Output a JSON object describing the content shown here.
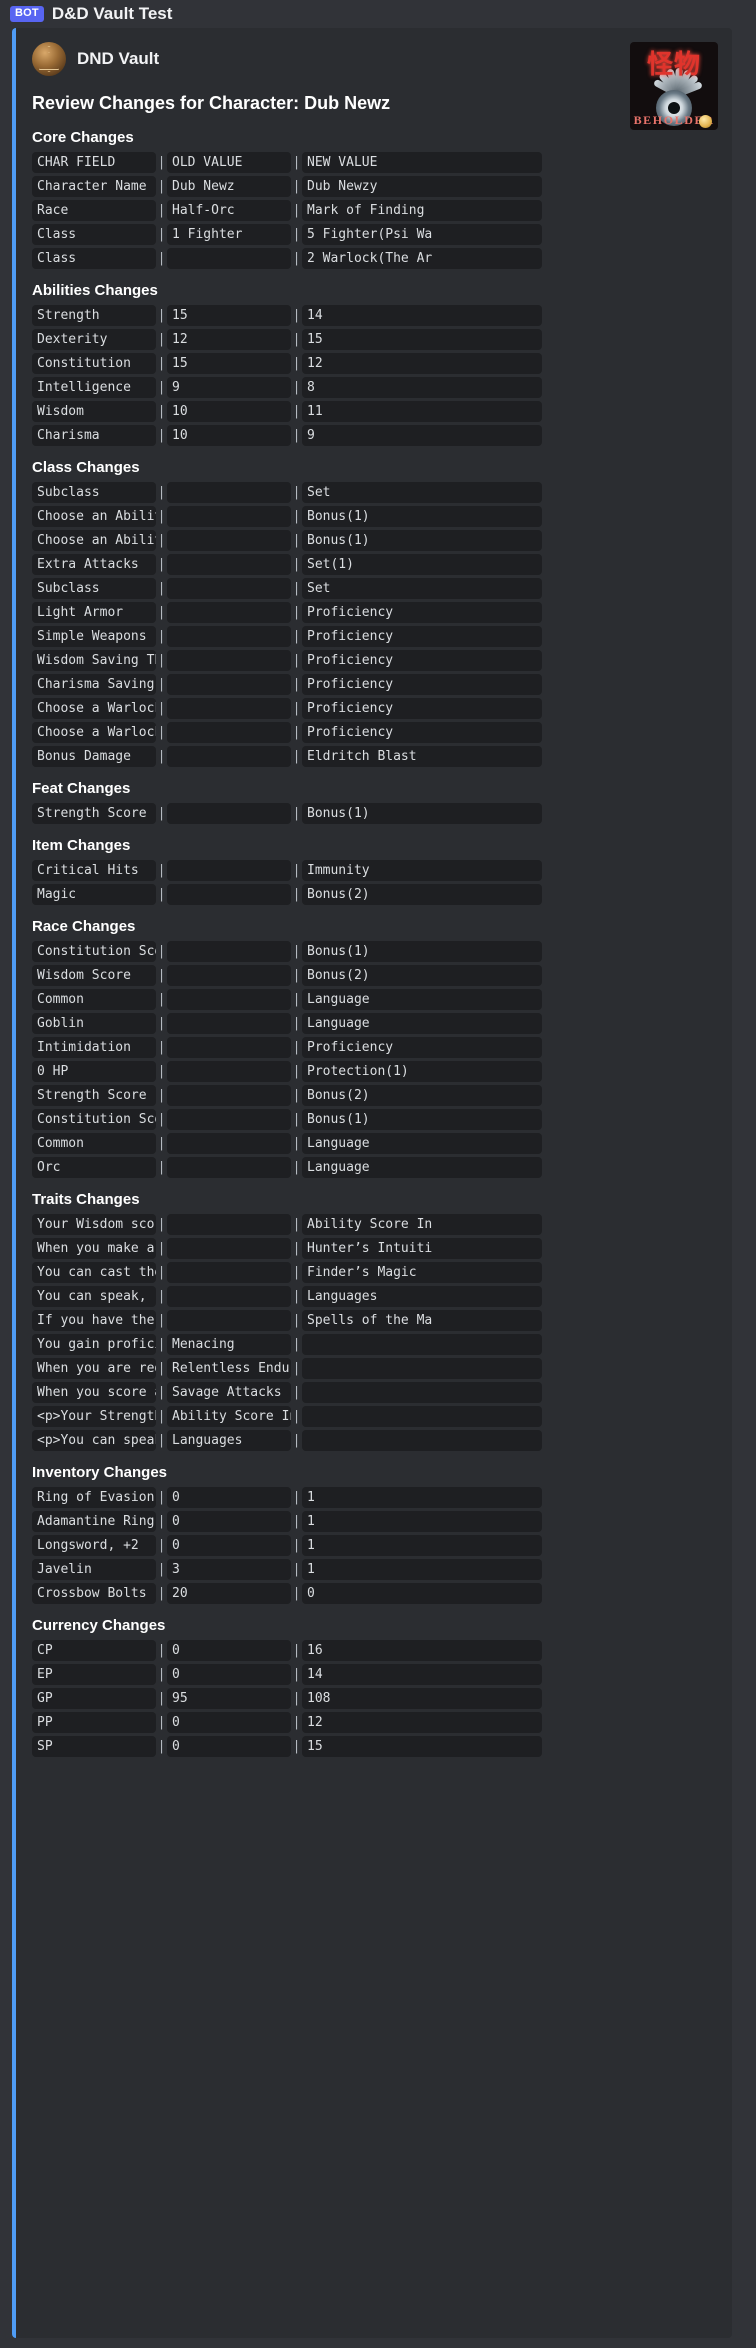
{
  "message": {
    "bot_tag": "BOT",
    "username": "D&D Vault Test"
  },
  "embed": {
    "author_name": "DND Vault",
    "author_icon": "d20-dice-icon",
    "title": "Review Changes for Character: Dub Newz",
    "thumbnail": {
      "kanji": "怪物",
      "caption": "BEHOLDER",
      "alt": "beholder-monster-thumbnail"
    },
    "accent_color": "#4f9cf5",
    "fields": [
      {
        "name": "Core Changes",
        "rows": [
          [
            "CHAR FIELD",
            "OLD VALUE",
            "NEW VALUE"
          ],
          [
            "Character Name",
            "Dub Newz",
            "Dub Newzy"
          ],
          [
            "Race",
            "Half-Orc",
            "Mark of Finding"
          ],
          [
            "Class",
            "1 Fighter",
            "5 Fighter(Psi Wa"
          ],
          [
            "Class",
            "",
            "2 Warlock(The Ar"
          ]
        ]
      },
      {
        "name": "Abilities Changes",
        "rows": [
          [
            "Strength",
            "15",
            "14"
          ],
          [
            "Dexterity",
            "12",
            "15"
          ],
          [
            "Constitution",
            "15",
            "12"
          ],
          [
            "Intelligence",
            "9",
            "8"
          ],
          [
            "Wisdom",
            "10",
            "11"
          ],
          [
            "Charisma",
            "10",
            "9"
          ]
        ]
      },
      {
        "name": "Class Changes",
        "rows": [
          [
            "Subclass",
            "",
            "Set"
          ],
          [
            "Choose an Abilit",
            "",
            "Bonus(1)"
          ],
          [
            "Choose an Abilit",
            "",
            "Bonus(1)"
          ],
          [
            "Extra Attacks",
            "",
            "Set(1)"
          ],
          [
            "Subclass",
            "",
            "Set"
          ],
          [
            "Light Armor",
            "",
            "Proficiency"
          ],
          [
            "Simple Weapons",
            "",
            "Proficiency"
          ],
          [
            "Wisdom Saving Th",
            "",
            "Proficiency"
          ],
          [
            "Charisma Saving",
            "",
            "Proficiency"
          ],
          [
            "Choose a Warlock",
            "",
            "Proficiency"
          ],
          [
            "Choose a Warlock",
            "",
            "Proficiency"
          ],
          [
            "Bonus Damage",
            "",
            "Eldritch Blast"
          ]
        ]
      },
      {
        "name": "Feat Changes",
        "rows": [
          [
            "Strength Score",
            "",
            "Bonus(1)"
          ]
        ]
      },
      {
        "name": "Item Changes",
        "rows": [
          [
            "Critical Hits",
            "",
            "Immunity"
          ],
          [
            "Magic",
            "",
            "Bonus(2)"
          ]
        ]
      },
      {
        "name": "Race Changes",
        "rows": [
          [
            "Constitution Sco",
            "",
            "Bonus(1)"
          ],
          [
            "Wisdom Score",
            "",
            "Bonus(2)"
          ],
          [
            "Common",
            "",
            "Language"
          ],
          [
            "Goblin",
            "",
            "Language"
          ],
          [
            "Intimidation",
            "",
            "Proficiency"
          ],
          [
            "0 HP",
            "",
            "Protection(1)"
          ],
          [
            "Strength Score",
            "",
            "Bonus(2)"
          ],
          [
            "Constitution Sco",
            "",
            "Bonus(1)"
          ],
          [
            "Common",
            "",
            "Language"
          ],
          [
            "Orc",
            "",
            "Language"
          ]
        ]
      },
      {
        "name": "Traits Changes",
        "rows": [
          [
            "Your Wisdom scor",
            "",
            "Ability Score In"
          ],
          [
            "When you make a",
            "",
            "Hunter’s Intuiti"
          ],
          [
            "You can cast the",
            "",
            "Finder’s Magic"
          ],
          [
            "You can speak, r",
            "",
            "Languages"
          ],
          [
            "If you have the",
            "",
            "Spells of the Ma"
          ],
          [
            "You gain profici",
            "Menacing",
            ""
          ],
          [
            "When you are red",
            "Relentless Endur",
            ""
          ],
          [
            "When you score a",
            "Savage Attacks",
            ""
          ],
          [
            "<p>Your Strength",
            "Ability Score In",
            ""
          ],
          [
            "<p>You can speak",
            "Languages",
            ""
          ]
        ]
      },
      {
        "name": "Inventory Changes",
        "rows": [
          [
            "Ring of Evasion",
            "0",
            "1"
          ],
          [
            "Adamantine Ring",
            "0",
            "1"
          ],
          [
            "Longsword, +2",
            "0",
            "1"
          ],
          [
            "Javelin",
            "3",
            "1"
          ],
          [
            "Crossbow Bolts",
            "20",
            "0"
          ]
        ]
      },
      {
        "name": "Currency Changes",
        "rows": [
          [
            "CP",
            "0",
            "16"
          ],
          [
            "EP",
            "0",
            "14"
          ],
          [
            "GP",
            "95",
            "108"
          ],
          [
            "PP",
            "0",
            "12"
          ],
          [
            "SP",
            "0",
            "15"
          ]
        ]
      }
    ]
  }
}
